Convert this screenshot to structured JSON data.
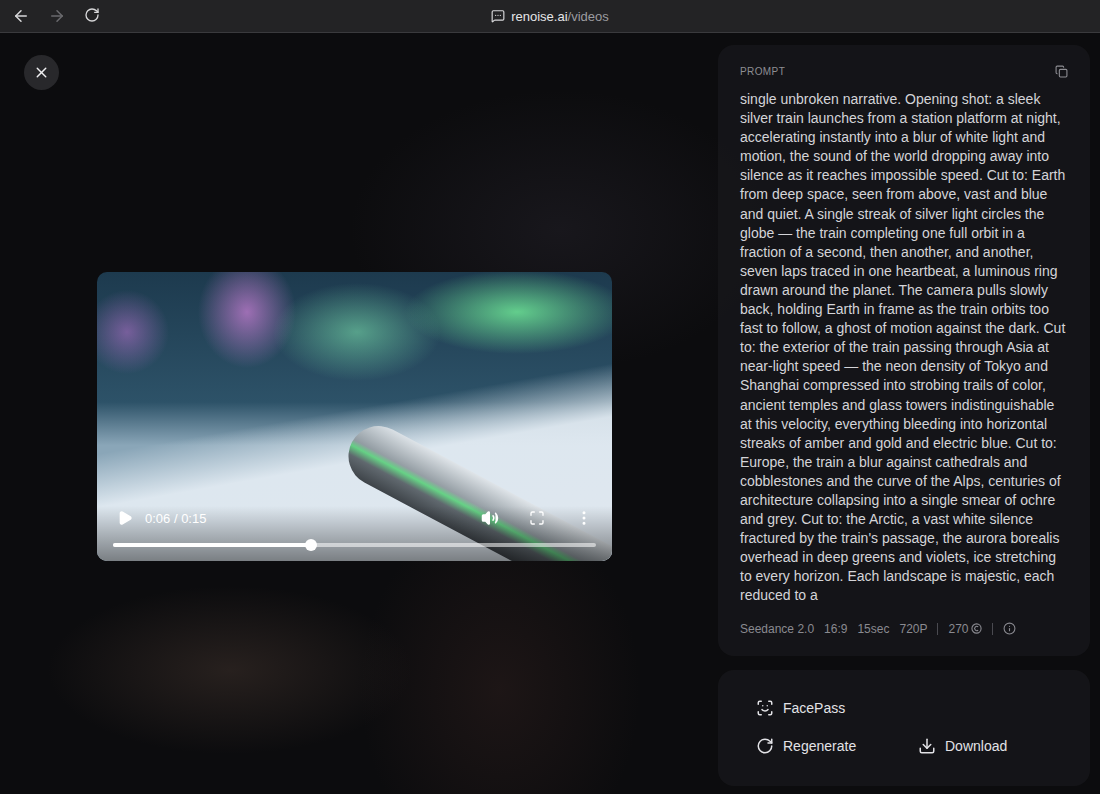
{
  "browser": {
    "url_host": "renoise.ai",
    "url_path": "/videos",
    "back_enabled": true,
    "forward_enabled": false
  },
  "player": {
    "time": "0:06 / 0:15",
    "level": 0.41,
    "playing": false
  },
  "prompt": {
    "label": "PROMPT",
    "text": "single unbroken narrative. Opening shot: a sleek silver train launches from a station platform at night, accelerating instantly into a blur of white light and motion, the sound of the world dropping away into silence as it reaches impossible speed. Cut to: Earth from deep space, seen from above, vast and blue and quiet. A single streak of silver light circles the globe — the train completing one full orbit in a fraction of a second, then another, and another, seven laps traced in one heartbeat, a luminous ring drawn around the planet. The camera pulls slowly back, holding Earth in frame as the train orbits too fast to follow, a ghost of motion against the dark. Cut to: the exterior of the train passing through Asia at near-light speed — the neon density of Tokyo and Shanghai compressed into strobing trails of color, ancient temples and glass towers indistinguishable at this velocity, everything bleeding into horizontal streaks of amber and gold and electric blue. Cut to: Europe, the train a blur against cathedrals and cobblestones and the curve of the Alps, centuries of architecture collapsing into a single smear of ochre and grey. Cut to: the Arctic, a vast white silence fractured by the train's passage, the aurora borealis overhead in deep greens and violets, ice stretching to every horizon. Each landscape is majestic, each reduced to a"
  },
  "meta": [
    "Seedance 2.0",
    "16:9",
    "15sec",
    "720P"
  ],
  "credits": "270",
  "actions": [
    {
      "label": "FacePass",
      "kind": "scan"
    },
    {
      "label": "Regenerate",
      "kind": "refresh"
    },
    {
      "label": "Download",
      "kind": "download"
    }
  ]
}
